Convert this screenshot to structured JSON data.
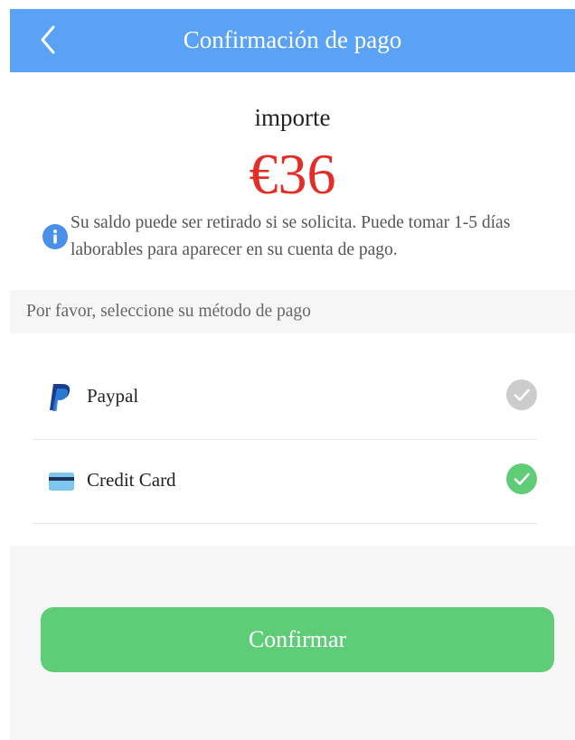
{
  "header": {
    "title": "Confirmación de pago",
    "back_icon": "chevron-left-icon"
  },
  "amount": {
    "label": "importe",
    "value": "€36"
  },
  "info": {
    "icon": "info-icon",
    "text": "Su saldo puede ser retirado si se solicita. Puede tomar 1-5 días laborables para aparecer en su cuenta de pago."
  },
  "payment": {
    "section_label": "Por favor, seleccione su método de pago",
    "methods": [
      {
        "label": "Paypal",
        "icon": "paypal-icon",
        "selected": false
      },
      {
        "label": "Credit Card",
        "icon": "credit-card-icon",
        "selected": true
      }
    ]
  },
  "confirm": {
    "label": "Confirmar"
  },
  "colors": {
    "header": "#5aa2f5",
    "amount": "#e52d27",
    "selected_check": "#5fcd77",
    "unselected_check": "#cccccc",
    "confirm_button": "#5fcd77"
  }
}
